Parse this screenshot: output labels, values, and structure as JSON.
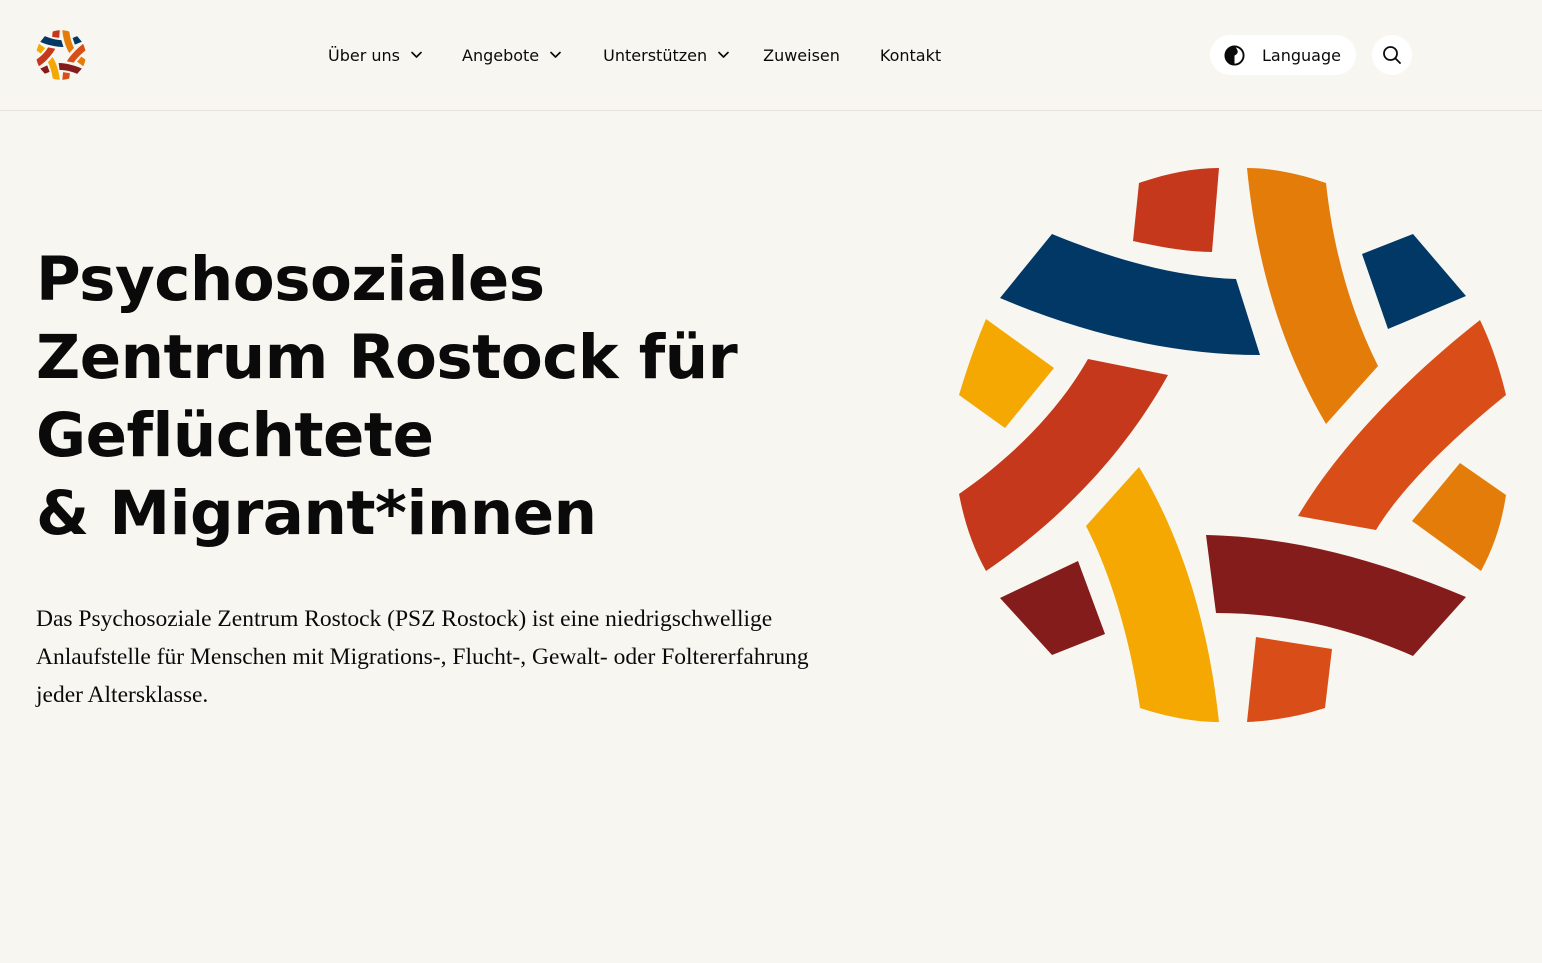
{
  "header": {
    "logo_icon": "psz-emblem-logo",
    "nav": [
      {
        "label": "Über uns",
        "has_dropdown": true
      },
      {
        "label": "Angebote",
        "has_dropdown": true
      },
      {
        "label": "Unterstützen",
        "has_dropdown": true
      },
      {
        "label": "Zuweisen",
        "has_dropdown": false
      },
      {
        "label": "Kontakt",
        "has_dropdown": false
      }
    ],
    "language_label": "Language",
    "language_icon": "contrast-icon",
    "search_icon": "search-icon"
  },
  "hero": {
    "title_lines": [
      "Psychosoziales",
      "Zentrum Rostock für",
      "Geflüchtete",
      "& Migrant*innen"
    ],
    "description": "Das Psychosoziale Zentrum Rostock (PSZ Rostock) ist eine niedrigschwellige Anlaufstelle für Menschen mit Migrations-, Flucht-, Gewalt- oder Foltererfahrung jeder Altersklasse.",
    "emblem_icon": "psz-emblem"
  },
  "colors": {
    "background": "#f8f6f1",
    "navy": "#023866",
    "orange": "#e47c0a",
    "red": "#c5381c",
    "yellow": "#f4a801",
    "dark_red": "#831c1a",
    "red_orange": "#d94e18"
  }
}
